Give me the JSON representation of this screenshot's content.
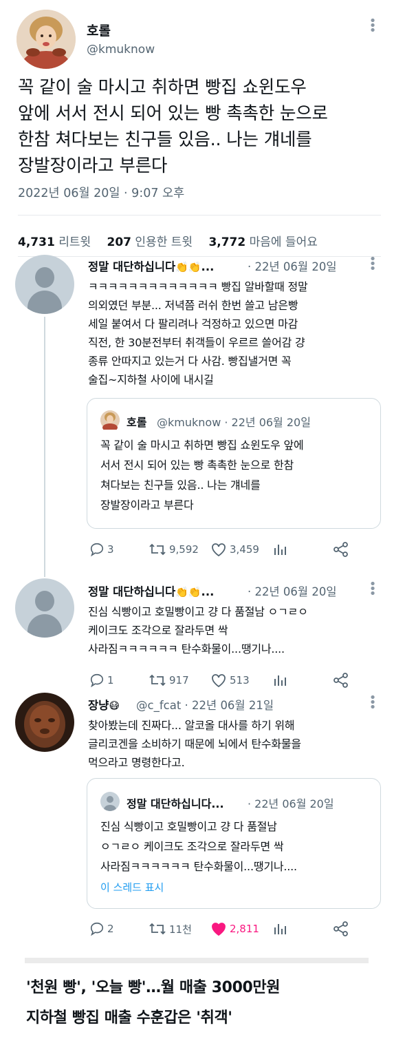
{
  "main_tweet": {
    "name": "호롤",
    "handle": "@kmuknow",
    "text_lines": [
      "꼭 같이 술 마시고 취하면 빵집 쇼윈도우",
      "앞에 서서 전시 되어 있는 빵 촉촉한 눈으로",
      "한참 쳐다보는 친구들 있음.. 나는 걔네를",
      "장발장이라고 부른다"
    ],
    "timestamp": "2022년 06월 20일 · 9:07 오후",
    "retweets": "4,731",
    "retweets_label": "리트윗",
    "quotes": "207",
    "quotes_label": "인용한 트윗",
    "likes": "3,772",
    "likes_label": "마음에 들어요"
  },
  "replies": [
    {
      "name": "정말 대단하십니다",
      "name_suffix": "...",
      "meta": "· 22년 06월 20일",
      "text_lines": [
        "ㅋㅋㅋㅋㅋㅋㅋㅋㅋㅋㅋㅋㅋ 빵집 알바할때 정말",
        "의외였던 부분... 저녁쯤 러쉬 한번 쓸고 남은빵",
        "세일 붙여서 다 팔리려나 걱정하고 있으면 마감",
        "직전, 한 30분전부터 취객들이 우르르 쓸어감 걍",
        "종류 안따지고 있는거 다 사감. 빵집낼거면 꼭",
        "술집~지하철 사이에 내시길"
      ],
      "quote": {
        "name": "호롤",
        "handle_meta": "@kmuknow · 22년 06월 20일",
        "text_lines": [
          "꼭 같이 술 마시고 취하면 빵집 쇼윈도우 앞에",
          "서서 전시 되어 있는 빵 촉촉한 눈으로 한참",
          "쳐다보는 친구들 있음.. 나는 걔네를",
          "장발장이라고 부른다"
        ]
      },
      "replies_count": "3",
      "retweets_count": "9,592",
      "likes_count": "3,459"
    },
    {
      "name": "정말 대단하십니다",
      "name_suffix": "...",
      "meta": "· 22년 06월 20일",
      "text_lines": [
        "진심 식빵이고 호밀빵이고 걍 다 품절남 ㅇㄱㄹㅇ",
        "케이크도 조각으로 잘라두면 싹",
        "사라짐ㅋㅋㅋㅋㅋㅋ 탄수화물이...땡기나...."
      ],
      "replies_count": "1",
      "retweets_count": "917",
      "likes_count": "513"
    },
    {
      "name": "장냥",
      "handle_meta": "@c_fcat · 22년 06월 21일",
      "text_lines": [
        "찾아봤는데 진짜다... 알코올 대사를 하기 위해",
        "글리코겐을 소비하기 때문에 뇌에서 탄수화물을",
        "먹으라고 명령한다고."
      ],
      "quote": {
        "name": "정말 대단하십니다...",
        "handle_meta": "· 22년 06월 20일",
        "text_lines": [
          "진심 식빵이고 호밀빵이고 걍 다 품절남",
          "ㅇㄱㄹㅇ 케이크도 조각으로 잘라두면 싹",
          "사라짐ㅋㅋㅋㅋㅋㅋ 탄수화물이...땡기나...."
        ],
        "show_thread": "이 스레드 표시"
      },
      "replies_count": "2",
      "retweets_count": "11천",
      "likes_count": "2,811"
    }
  ],
  "headline": {
    "line1": "'천원 빵', '오늘 빵'…월 매출 3000만원",
    "line2": "지하철 빵집 매출 수훈갑은 '취객'"
  },
  "colors": {
    "text": "#0f1419",
    "secondary": "#536471",
    "like_active": "#f91880",
    "link": "#1d9bf0",
    "divider": "#e6e9ec"
  },
  "icons": {
    "reply": "speech-bubble-icon",
    "retweet": "retweet-arrows-icon",
    "like": "heart-icon",
    "analytics": "bar-chart-icon",
    "share": "share-nodes-icon",
    "more": "vertical-dots-icon",
    "clap": "clapping-hands-emoji"
  }
}
